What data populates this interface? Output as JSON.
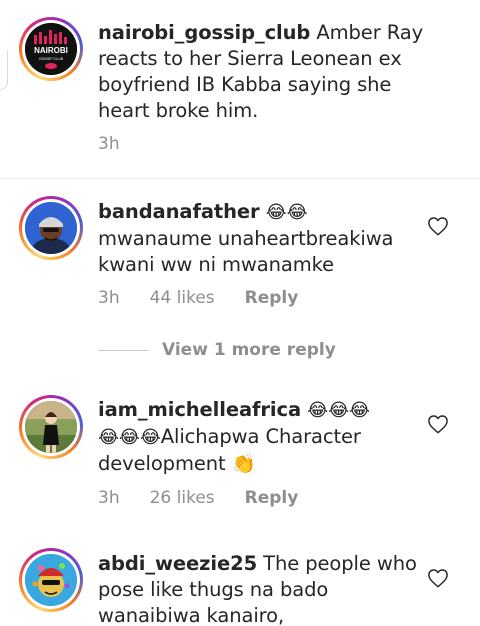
{
  "comments": [
    {
      "username": "nairobi_gossip_club",
      "text": " Amber Ray reacts to her Sierra Leonean ex boyfriend IB Kabba saying she heart broke him.",
      "avatar_label": "NAIROBI",
      "avatar_sublabel": "GOSSIP CLUB",
      "time": "3h"
    },
    {
      "username": "bandanafather",
      "emoji_after_name": "😂😂",
      "text": "mwanaume unaheartbreakiwa kwani ww ni mwanamke",
      "time": "3h",
      "likes": "44 likes",
      "reply": "Reply",
      "view_more": "View 1 more reply"
    },
    {
      "username": "iam_michelleafrica",
      "emoji_after_name": "😂😂😂",
      "line2_emoji": "😂😂😂",
      "text": "Alichapwa Character development 👏",
      "time": "3h",
      "likes": "26 likes",
      "reply": "Reply"
    },
    {
      "username": "abdi_weezie25",
      "text": " The people who pose like thugs na bado wanaibiwa kanairo,"
    }
  ],
  "colors": {
    "text": "#262626",
    "muted": "#8e8e8e",
    "story_ring": [
      "#feda75",
      "#fa7e1e",
      "#d62976",
      "#962fbf",
      "#4f5bd5"
    ]
  }
}
